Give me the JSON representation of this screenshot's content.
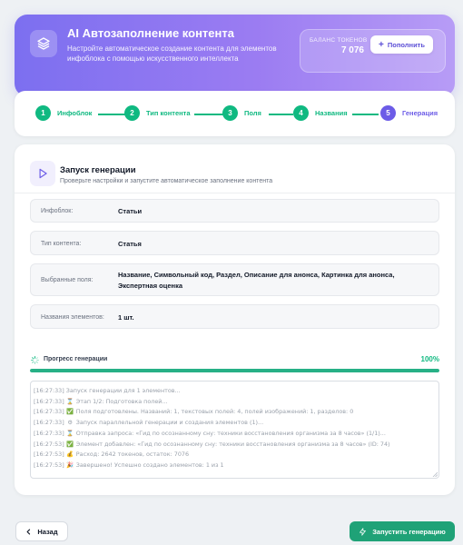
{
  "header": {
    "title": "AI Автозаполнение контента",
    "subtitle": "Настройте автоматическое создание контента для элементов инфоблока с помощью искусственного интеллекта",
    "balance_label": "БАЛАНС ТОКЕНОВ",
    "balance_value": "7 076",
    "topup_label": "Пополнить",
    "icon": "layers-icon"
  },
  "stepper": {
    "steps": [
      {
        "num": "1",
        "label": "Инфоблок",
        "state": "done"
      },
      {
        "num": "2",
        "label": "Тип контента",
        "state": "done"
      },
      {
        "num": "3",
        "label": "Поля",
        "state": "done"
      },
      {
        "num": "4",
        "label": "Названия",
        "state": "done"
      },
      {
        "num": "5",
        "label": "Генерация",
        "state": "active"
      }
    ]
  },
  "launch": {
    "title": "Запуск генерации",
    "subtitle": "Проверьте настройки и запустите автоматическое заполнение контента",
    "icon": "play-icon"
  },
  "summary": [
    {
      "label": "Инфоблок:",
      "value": "Статьи"
    },
    {
      "label": "Тип контента:",
      "value": "Статья"
    },
    {
      "label": "Выбранные поля:",
      "value": "Название, Символьный код, Раздел, Описание для анонса, Картинка для анонса, Экспертная оценка"
    },
    {
      "label": "Названия элементов:",
      "value": "1 шт."
    }
  ],
  "progress": {
    "label": "Прогресс генерации",
    "percent_text": "100%",
    "fraction": 1.0
  },
  "log": [
    {
      "time": "[16:27:33]",
      "icon": "",
      "text": "Запуск генерации для 1 элементов..."
    },
    {
      "time": "[16:27:33]",
      "icon": "⌛",
      "text": "Этап 1/2: Подготовка полей..."
    },
    {
      "time": "[16:27:33]",
      "icon": "✅",
      "text": "Поля подготовлены. Названий: 1, текстовых полей: 4, полей изображений: 1, разделов: 0"
    },
    {
      "time": "[16:27:33]",
      "icon": "⚙",
      "text": "Запуск параллельной генерации и создания элементов (1)..."
    },
    {
      "time": "[16:27:33]",
      "icon": "⌛",
      "text": "Отправка запроса: «Гид по осознанному сну: техники восстановления организма за 8 часов» (1/1)..."
    },
    {
      "time": "[16:27:53]",
      "icon": "✅",
      "text": "Элемент добавлен: «Гид по осознанному сну: техники восстановления организма за 8 часов» (ID: 74)"
    },
    {
      "time": "[16:27:53]",
      "icon": "💰",
      "text": "Расход: 2642 токенов, остаток: 7076"
    },
    {
      "time": "[16:27:53]",
      "icon": "🎉",
      "text": "Завершено! Успешно создано элементов: 1 из 1"
    }
  ],
  "footer": {
    "back_label": "Назад",
    "start_label": "Запустить генерацию"
  },
  "colors": {
    "accent": "#6c5ce7",
    "success": "#10b981",
    "start_button": "#1fa277"
  }
}
